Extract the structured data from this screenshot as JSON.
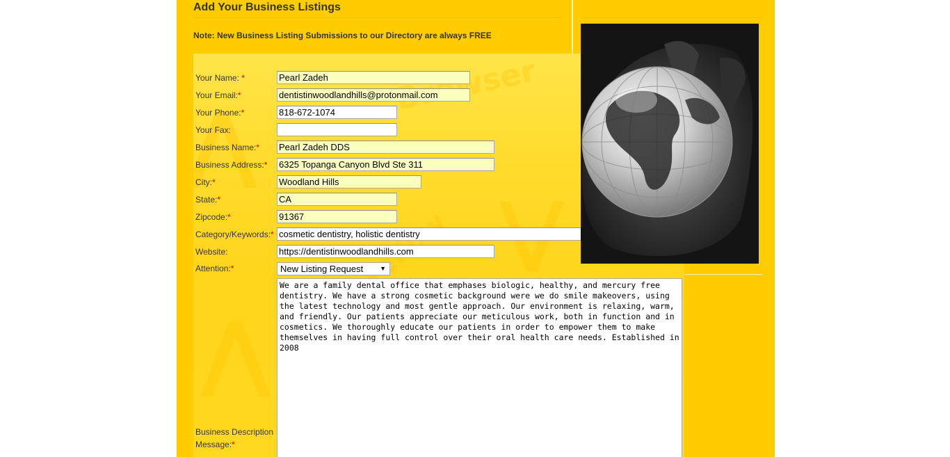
{
  "heading": "Add Your Business Listings",
  "note": "Note: New Business Listing Submissions to our Directory are always FREE",
  "form": {
    "required_mark": "*",
    "fields": {
      "name": {
        "label": "Your Name:",
        "value": "Pearl Zadeh"
      },
      "email": {
        "label": "Your Email:",
        "value": "dentistinwoodlandhills@protonmail.com"
      },
      "phone": {
        "label": "Your Phone:",
        "value": "818-672-1074"
      },
      "fax": {
        "label": "Your Fax:",
        "value": ""
      },
      "business_name": {
        "label": "Business Name:",
        "value": "Pearl Zadeh DDS"
      },
      "business_address": {
        "label": "Business Address:",
        "value": "6325 Topanga Canyon Blvd Ste 311"
      },
      "city": {
        "label": "City:",
        "value": "Woodland Hills"
      },
      "state": {
        "label": "State:",
        "value": "CA"
      },
      "zipcode": {
        "label": "Zipcode:",
        "value": "91367"
      },
      "category": {
        "label": "Category/Keywords:",
        "value": "cosmetic dentistry, holistic dentistry"
      },
      "website": {
        "label": "Website:",
        "value": "https://dentistinwoodlandhills.com"
      },
      "attention": {
        "label": "Attention:",
        "value": "New Listing Request"
      },
      "description": {
        "label_line1": "Business Description",
        "label_line2": "Message:",
        "value": "We are a family dental office that emphases biologic, healthy, and mercury free dentistry. We have a strong cosmetic background were we do smile makeovers, using the latest technology and most gentle approach. Our environment is relaxing, warm, and friendly. Our patients appreciate our meticulous work, both in function and in cosmetics. We thoroughly educate our patients in order to empower them to make themselves in having full control over their oral health care needs. Established in 2008"
      }
    }
  },
  "colors": {
    "page_background": "#ffcc00",
    "autofill_background": "#fbffbd",
    "required_mark": "#cc0000"
  },
  "icons": {
    "select_arrow": "chevron-down-icon",
    "photo": "globe-in-hand-photo"
  }
}
